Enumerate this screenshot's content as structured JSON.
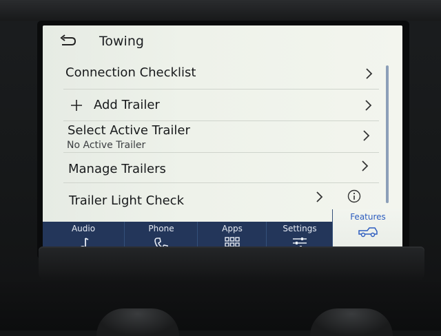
{
  "header": {
    "title": "Towing"
  },
  "list": {
    "items": [
      {
        "label": "Connection Checklist"
      },
      {
        "label": "Add Trailer"
      },
      {
        "label": "Select Active Trailer",
        "sublabel": "No Active Trailer"
      },
      {
        "label": "Manage Trailers"
      },
      {
        "label": "Trailer Light Check"
      }
    ]
  },
  "tabs": [
    {
      "label": "Audio",
      "icon": "music-note-icon"
    },
    {
      "label": "Phone",
      "icon": "phone-icon"
    },
    {
      "label": "Apps",
      "icon": "apps-grid-icon"
    },
    {
      "label": "Settings",
      "icon": "sliders-icon"
    },
    {
      "label": "Features",
      "icon": "truck-icon",
      "active": true
    }
  ],
  "colors": {
    "screen_bg": "#eef2ea",
    "text": "#17191b",
    "tabbar_bg": "#23365a",
    "active_accent": "#2c5cbf"
  }
}
